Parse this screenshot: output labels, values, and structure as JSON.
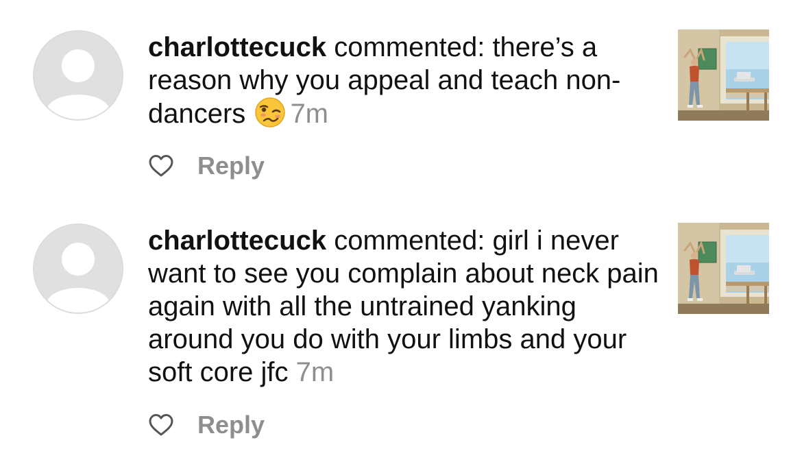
{
  "notifications": [
    {
      "username": "charlottecuck",
      "action": " commented: ",
      "comment": "there’s a reason why you appeal and teach non-dancers",
      "emoji": "woozy-face-emoji",
      "time": "7m",
      "reply_label": "Reply",
      "like_icon": "heart-outline-icon",
      "avatar_icon": "default-avatar-icon",
      "thumbnail": "post-thumbnail-dancer-by-window"
    },
    {
      "username": "charlottecuck",
      "action": " commented: ",
      "comment": "girl i never want to see you complain about neck pain again with all the untrained yanking around you do with your limbs and your soft core jfc",
      "time": "7m",
      "reply_label": "Reply",
      "like_icon": "heart-outline-icon",
      "avatar_icon": "default-avatar-icon",
      "thumbnail": "post-thumbnail-dancer-by-window"
    }
  ],
  "colors": {
    "text": "#111111",
    "secondary_text": "#8e8e8e",
    "avatar_background": "#e0e0e0",
    "avatar_silhouette": "#ffffff"
  }
}
